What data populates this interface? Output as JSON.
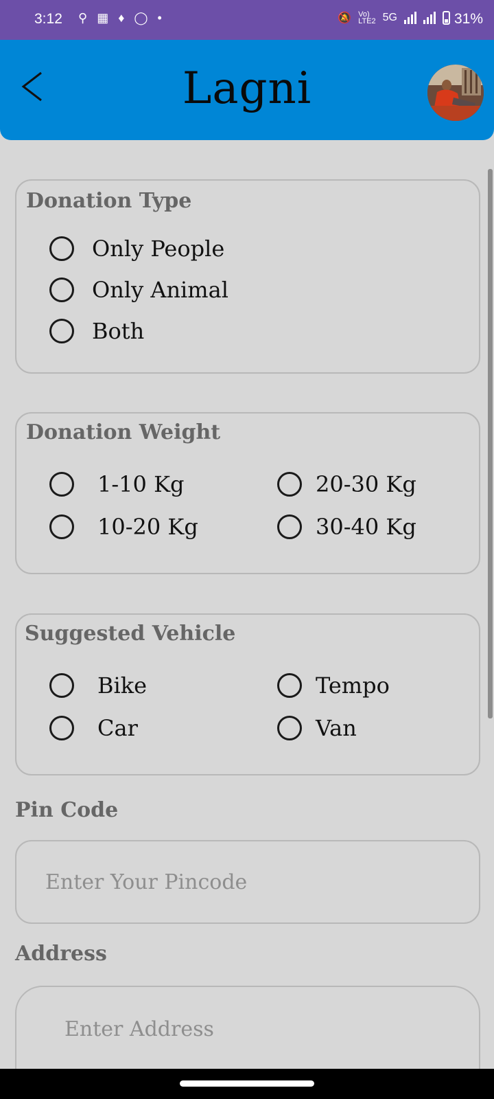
{
  "status_bar": {
    "time": "3:12",
    "network": "5G",
    "battery_percent": "31%",
    "battery_level": 0.31
  },
  "app_bar": {
    "title": "Lagni"
  },
  "donation_type": {
    "title": "Donation Type",
    "options": [
      "Only People",
      "Only Animal",
      "Both"
    ]
  },
  "donation_weight": {
    "title": "Donation Weight",
    "options": [
      "1-10 Kg",
      "20-30 Kg",
      "10-20 Kg",
      "30-40 Kg"
    ]
  },
  "suggested_vehicle": {
    "title": "Suggested Vehicle",
    "options": [
      "Bike",
      "Tempo",
      "Car",
      "Van"
    ]
  },
  "pin_code": {
    "label": "Pin Code",
    "placeholder": "Enter Your Pincode",
    "value": ""
  },
  "address": {
    "label": "Address",
    "placeholder": "Enter Address",
    "value": ""
  },
  "colors": {
    "status_bar": "#6c4fa8",
    "app_bar": "#0086d6",
    "background": "#d7d7d7",
    "heading_text": "#666666"
  }
}
